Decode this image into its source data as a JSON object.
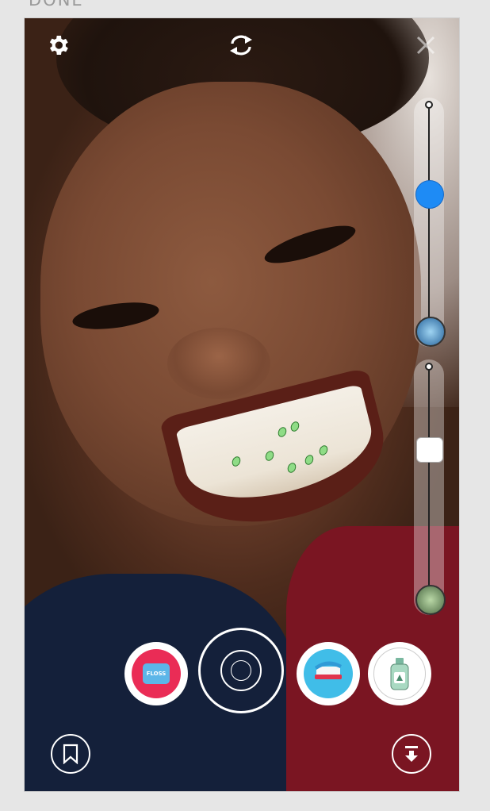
{
  "header": {
    "done_label": "DONE"
  },
  "toolbar": {
    "settings_icon": "gear-icon",
    "switch_camera_icon": "switch-camera-icon",
    "close_icon": "close-icon"
  },
  "sliders": [
    {
      "name": "rinse-level-slider",
      "value_fraction": 0.37,
      "knob": "blue-circle",
      "end_icon": "rinse-icon"
    },
    {
      "name": "germ-level-slider",
      "value_fraction": 0.33,
      "knob": "white-square",
      "end_icon": "germ-icon"
    }
  ],
  "tools": [
    {
      "name": "floss",
      "label": "FLOSS",
      "color": "#ea2c56"
    },
    {
      "name": "shutter",
      "label": ""
    },
    {
      "name": "toothbrush",
      "color": "#40bde8"
    },
    {
      "name": "mouthwash",
      "color": "#ffffff"
    }
  ],
  "bottom_bar": {
    "bookmark_icon": "bookmark-icon",
    "download_icon": "download-icon"
  }
}
